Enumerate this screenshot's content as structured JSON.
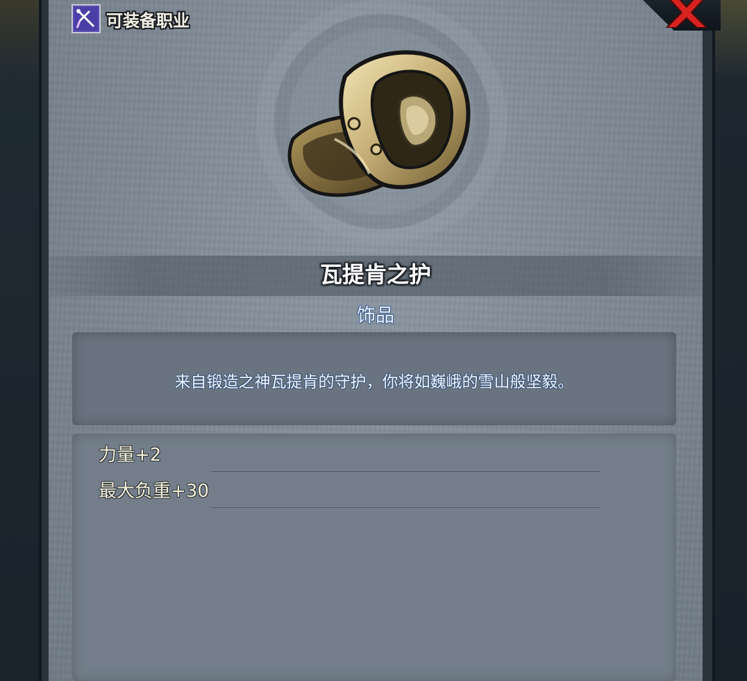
{
  "header": {
    "class_label": "可装备职业",
    "class_icon": "crossed-swords-icon",
    "close_icon": "close-x-icon"
  },
  "item": {
    "icon": "gold-ring-icon",
    "name": "瓦提肯之护",
    "type": "饰品",
    "description": "来自锻造之神瓦提肯的守护，你将如巍峨的雪山般坚毅。",
    "stats": [
      {
        "label": "力量+2"
      },
      {
        "label": "最大负重+30"
      }
    ]
  },
  "colors": {
    "panel": "#7d8893",
    "type_text": "#e8f0ff",
    "close_red": "#d8231f",
    "ring_gold": "#c9b27a"
  }
}
